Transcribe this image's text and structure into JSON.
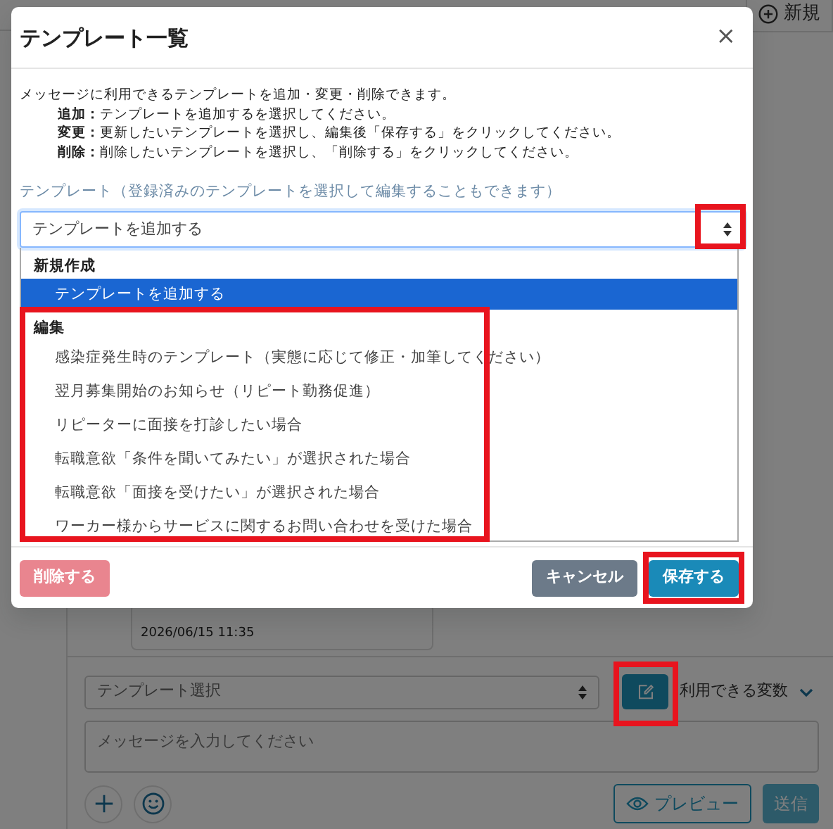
{
  "page": {
    "new_button": "新規",
    "message_time": "2026/06/15 11:35",
    "composer": {
      "template_select": {
        "value": "テンプレート選択"
      },
      "variables_label": "利用できる変数",
      "message_field": {
        "placeholder": "メッセージを入力してください"
      },
      "preview_button": "プレビュー",
      "send_button": "送信"
    }
  },
  "modal": {
    "title": "テンプレート一覧",
    "close": "×",
    "intro": "メッセージに利用できるテンプレートを追加・変更・削除できます。",
    "instructions": [
      "**追加：**テンプレートを追加するを選択してください。",
      "**変更：**更新したいテンプレートを選択し、編集後「保存する」をクリックしてください。",
      "**削除：**削除したいテンプレートを選択し、「削除する」をクリックしてください。"
    ],
    "template_label": "テンプレート",
    "template_hint": "（登録済みのテンプレートを選択して編集することもできます）",
    "template_select": {
      "value": "テンプレートを追加する",
      "expanded": true
    },
    "option_groups": [
      {
        "label": "新規作成",
        "options": [
          {
            "label": "テンプレートを追加する",
            "selected": true
          }
        ]
      },
      {
        "label": "編集",
        "options": [
          {
            "label": "感染症発生時のテンプレート（実態に応じて修正・加筆してください）",
            "selected": false
          },
          {
            "label": "翌月募集開始のお知らせ（リピート勤務促進）",
            "selected": false
          },
          {
            "label": "リピーターに面接を打診したい場合",
            "selected": false
          },
          {
            "label": "転職意欲「条件を聞いてみたい」が選択された場合",
            "selected": false
          },
          {
            "label": "転職意欲「面接を受けたい」が選択された場合",
            "selected": false
          },
          {
            "label": "ワーカー様からサービスに関するお問い合わせを受けた場合",
            "selected": false
          }
        ]
      }
    ],
    "buttons": [
      {
        "label": "削除する",
        "kind": "danger",
        "disabled": true
      },
      {
        "label": "キャンセル",
        "kind": "secondary",
        "disabled": false
      },
      {
        "label": "保存する",
        "kind": "primary",
        "disabled": false
      }
    ]
  }
}
